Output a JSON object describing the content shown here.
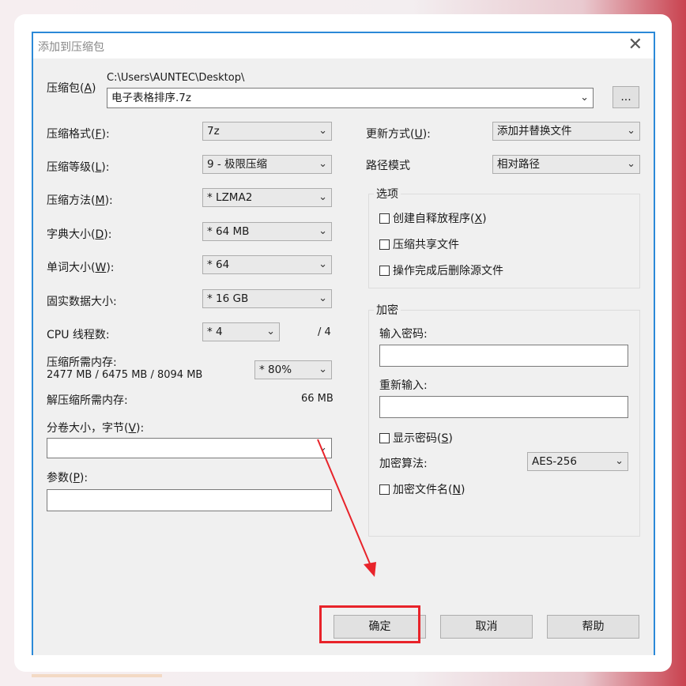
{
  "dialog": {
    "title": "添加到压缩包",
    "close_symbol": "✕",
    "archive": {
      "label": "压缩包(A)",
      "label_prefix": "压缩包(",
      "label_key": "A",
      "label_suffix": ")",
      "path": "C:\\Users\\AUNTEC\\Desktop\\",
      "filename": "电子表格排序.7z",
      "browse_label": "..."
    },
    "left": {
      "format": {
        "label_prefix": "压缩格式(",
        "label_key": "F",
        "label_suffix": "):",
        "value": "7z"
      },
      "level": {
        "label_prefix": "压缩等级(",
        "label_key": "L",
        "label_suffix": "):",
        "value": "9 - 极限压缩"
      },
      "method": {
        "label_prefix": "压缩方法(",
        "label_key": "M",
        "label_suffix": "):",
        "value": "*  LZMA2"
      },
      "dict": {
        "label_prefix": "字典大小(",
        "label_key": "D",
        "label_suffix": "):",
        "value": "*  64 MB"
      },
      "word": {
        "label_prefix": "单词大小(",
        "label_key": "W",
        "label_suffix": "):",
        "value": "*  64"
      },
      "solid": {
        "label": "固实数据大小:",
        "value": "*  16 GB"
      },
      "threads": {
        "label": "CPU 线程数:",
        "value": "*  4",
        "max": "/ 4"
      },
      "mem_compress": {
        "label": "压缩所需内存:",
        "detail": "2477 MB / 6475 MB / 8094 MB",
        "value": "* 80%"
      },
      "mem_decompress": {
        "label": "解压缩所需内存:",
        "value": "66 MB"
      },
      "volume": {
        "label_prefix": "分卷大小，字节(",
        "label_key": "V",
        "label_suffix": "):",
        "value": ""
      },
      "params": {
        "label_prefix": "参数(",
        "label_key": "P",
        "label_suffix": "):",
        "value": ""
      }
    },
    "right": {
      "update": {
        "label_prefix": "更新方式(",
        "label_key": "U",
        "label_suffix": "):",
        "value": "添加并替换文件"
      },
      "path_mode": {
        "label": "路径模式",
        "value": "相对路径"
      },
      "options": {
        "title": "选项",
        "sfx": {
          "label_prefix": "创建自释放程序(",
          "label_key": "X",
          "label_suffix": ")",
          "checked": false
        },
        "shared": {
          "label": "压缩共享文件",
          "checked": false
        },
        "delete": {
          "label": "操作完成后删除源文件",
          "checked": false
        }
      },
      "encryption": {
        "title": "加密",
        "password_label": "输入密码:",
        "password_value": "",
        "reenter_label": "重新输入:",
        "reenter_value": "",
        "show_pw": {
          "label_prefix": "显示密码(",
          "label_key": "S",
          "label_suffix": ")",
          "checked": false
        },
        "method_label": "加密算法:",
        "method_value": "AES-256",
        "encrypt_names": {
          "label_prefix": "加密文件名(",
          "label_key": "N",
          "label_suffix": ")",
          "checked": false
        }
      }
    },
    "buttons": {
      "ok": "确定",
      "cancel": "取消",
      "help": "帮助"
    }
  },
  "colors": {
    "accent": "#2b89d8",
    "annotation": "#e8232a"
  },
  "icons": {
    "dropdown": "▾",
    "close": "close-icon"
  }
}
